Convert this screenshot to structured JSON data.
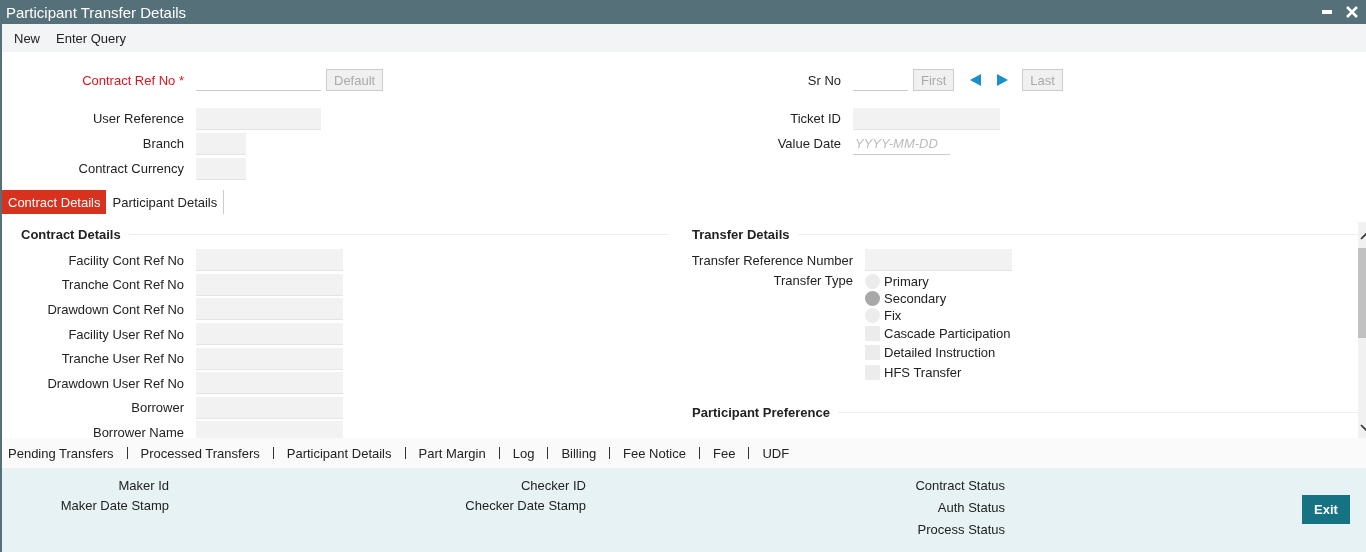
{
  "window": {
    "title": "Participant Transfer Details"
  },
  "toolbar": [
    {
      "label": "New"
    },
    {
      "label": "Enter Query"
    }
  ],
  "header": {
    "contract_ref": {
      "label": "Contract Ref No",
      "required_mark": "*",
      "button": {
        "label": "Default",
        "disabled": true
      }
    },
    "left_fields": [
      {
        "label": "User Reference"
      },
      {
        "label": "Branch"
      },
      {
        "label": "Contract Currency"
      }
    ],
    "sr_no": {
      "label": "Sr No",
      "first": {
        "label": "First",
        "disabled": true
      },
      "last": {
        "label": "Last",
        "disabled": true
      }
    },
    "ticket_id": {
      "label": "Ticket ID"
    },
    "value_date": {
      "label": "Value Date",
      "placeholder": "YYYY-MM-DD"
    }
  },
  "tabs": [
    {
      "label": "Contract Details",
      "selected": true
    },
    {
      "label": "Participant Details",
      "selected": false
    }
  ],
  "contract_details": {
    "title": "Contract Details",
    "fields": [
      "Facility Cont Ref No",
      "Tranche Cont Ref No",
      "Drawdown Cont Ref No",
      "Facility User Ref No",
      "Tranche User Ref No",
      "Drawdown User Ref No",
      "Borrower",
      "Borrower Name"
    ]
  },
  "transfer_details": {
    "title": "Transfer Details",
    "reference": {
      "label": "Transfer Reference Number"
    },
    "transfer_type": {
      "label": "Transfer Type",
      "options": [
        {
          "label": "Primary",
          "selected": false
        },
        {
          "label": "Secondary",
          "selected": true
        },
        {
          "label": "Fix",
          "selected": false
        }
      ]
    },
    "checkboxes": [
      {
        "label": "Cascade Participation",
        "checked": false
      },
      {
        "label": "Detailed Instruction",
        "checked": false
      },
      {
        "label": "HFS Transfer",
        "checked": false
      }
    ]
  },
  "participant_preference": {
    "title": "Participant Preference"
  },
  "footer_links": [
    "Pending Transfers",
    "Processed Transfers",
    "Participant Details",
    "Part Margin",
    "Log",
    "Billing",
    "Fee Notice",
    "Fee",
    "UDF"
  ],
  "audit": {
    "columns": [
      [
        "Maker Id",
        "Maker Date Stamp"
      ],
      [
        "Checker ID",
        "Checker Date Stamp"
      ],
      [
        "Contract Status",
        "Auth Status",
        "Process Status"
      ]
    ],
    "exit": "Exit"
  }
}
